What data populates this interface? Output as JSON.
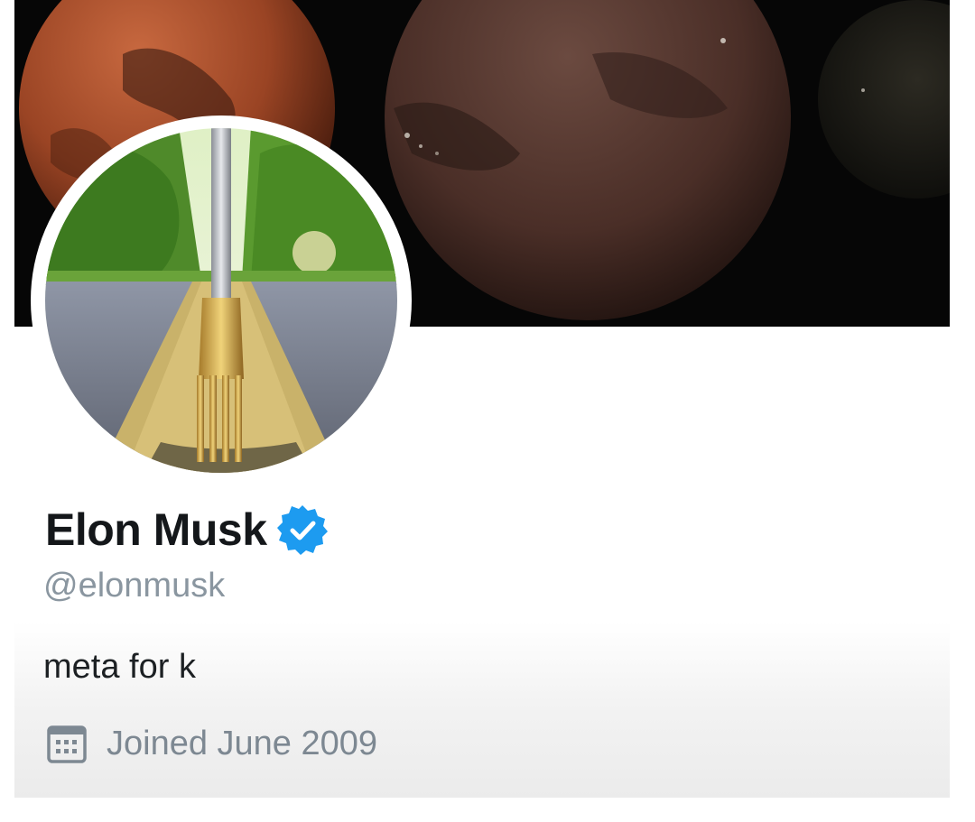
{
  "profile": {
    "name": "Elon Musk",
    "handle": "@elonmusk",
    "bio": "meta for k",
    "joined": "Joined June 2009",
    "verified": true
  },
  "icons": {
    "verified": "verified-badge-icon",
    "joined": "calendar-icon"
  },
  "colors": {
    "verified_blue": "#1d9bf0",
    "name_text": "#14171a",
    "secondary_text": "#8a96a0",
    "banner_background": "#050505"
  }
}
